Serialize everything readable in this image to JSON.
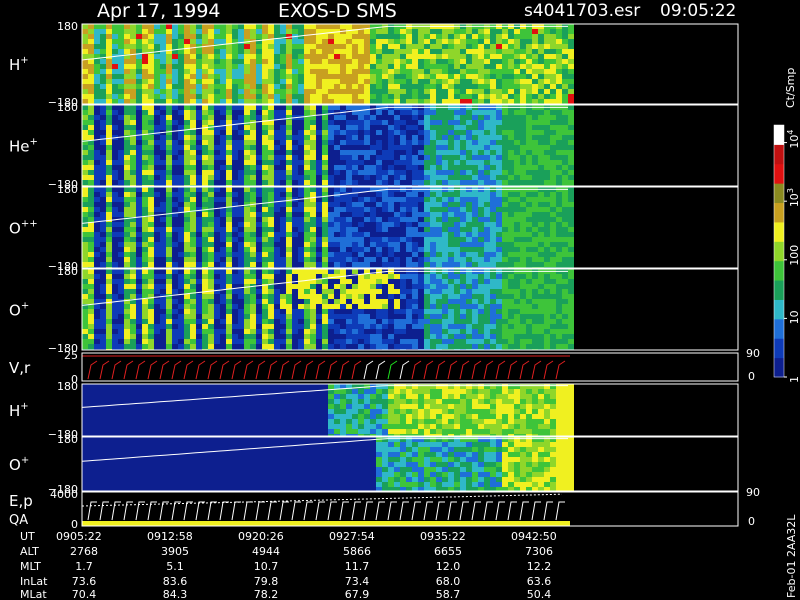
{
  "header": {
    "date": "Apr 17, 1994",
    "instrument": "EXOS-D SMS",
    "file": "s4041703.esr",
    "time": "09:05:22"
  },
  "colorbar": {
    "unit": "Ct/Smp",
    "ticks": [
      {
        "label": "1",
        "log": 0
      },
      {
        "label": "10",
        "log": 1
      },
      {
        "label": "100",
        "log": 2
      },
      {
        "label": "10",
        "sup": "3",
        "log": 3
      },
      {
        "label": "10",
        "sup": "4",
        "log": 4
      }
    ],
    "colors": [
      "#0d1f8f",
      "#0e3bb8",
      "#1f6fd8",
      "#2fb8c8",
      "#1aa05a",
      "#3ec43a",
      "#8fd62a",
      "#f0f020",
      "#c8a020",
      "#8a8a20",
      "#e01010",
      "#c01010",
      "#ffffff"
    ]
  },
  "panels": [
    {
      "id": "hp1",
      "species": "H",
      "charge": "+",
      "top": "180",
      "bottom": "−180",
      "kind": "spec",
      "pattern": "h1"
    },
    {
      "id": "hep",
      "species": "He",
      "charge": "+",
      "top": "180",
      "bottom": "−180",
      "kind": "spec",
      "pattern": "he"
    },
    {
      "id": "opp",
      "species": "O",
      "charge": "++",
      "top": "180",
      "bottom": "−180",
      "kind": "spec",
      "pattern": "o2"
    },
    {
      "id": "op1",
      "species": "O",
      "charge": "+",
      "top": "180",
      "bottom": "−180",
      "kind": "spec",
      "pattern": "o1"
    },
    {
      "id": "vr",
      "species": "V,r",
      "charge": "",
      "top": "25",
      "bottom": "0",
      "right_top": "90",
      "right_bottom": "0",
      "kind": "line"
    },
    {
      "id": "hp2",
      "species": "H",
      "charge": "+",
      "top": "180",
      "bottom": "−180",
      "kind": "spec",
      "pattern": "h2"
    },
    {
      "id": "op2",
      "species": "O",
      "charge": "+",
      "top": "180",
      "bottom": "−180",
      "kind": "spec",
      "pattern": "o3"
    },
    {
      "id": "ep",
      "species": "E,p",
      "species2": "QA",
      "charge": "",
      "top": "4000",
      "bottom": "0",
      "right_top": "90",
      "right_bottom": "0",
      "kind": "line2"
    }
  ],
  "ephemeris": {
    "labels": [
      "UT",
      "ALT",
      "MLT",
      "InLat",
      "MLat"
    ],
    "columns": [
      [
        "0905:22",
        "2768",
        "1.7",
        "73.6",
        "70.4"
      ],
      [
        "0912:58",
        "3905",
        "5.1",
        "83.6",
        "84.3"
      ],
      [
        "0920:26",
        "4944",
        "10.7",
        "79.8",
        "78.2"
      ],
      [
        "0927:54",
        "5866",
        "11.7",
        "73.4",
        "67.9"
      ],
      [
        "0935:22",
        "6655",
        "12.0",
        "68.0",
        "58.7"
      ],
      [
        "0942:50",
        "7306",
        "12.2",
        "63.6",
        "50.4"
      ]
    ]
  },
  "footer": {
    "stamp": "Feb-01 2AA32L"
  }
}
